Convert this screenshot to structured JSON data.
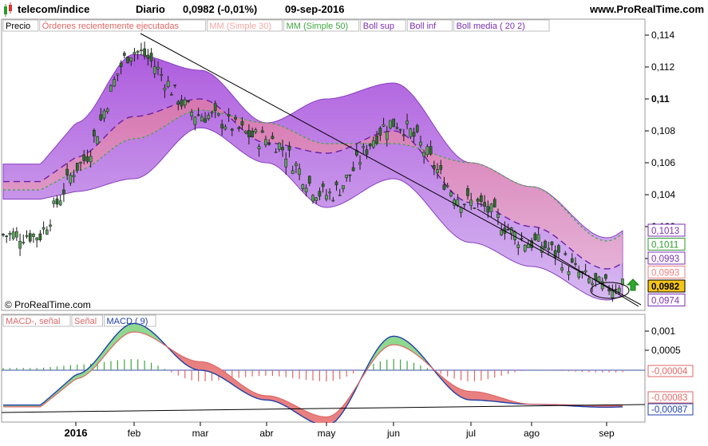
{
  "header": {
    "symbol": "telecom/indice",
    "period": "Diario",
    "last": "0,0982 (-0,01%)",
    "date": "09-sep-2016",
    "site": "www.ProRealTime.com",
    "logo_icon": "candlestick-icon"
  },
  "legend": {
    "items": [
      {
        "label": "Precio",
        "color": "#000000"
      },
      {
        "label": "Órdenes recientemente ejecutadas",
        "color": "#e06666"
      },
      {
        "label": "MM (Simple 30)",
        "color": "#f4a6a6"
      },
      {
        "label": "MM (Simple 50)",
        "color": "#3fa63f"
      },
      {
        "label": "Boll sup",
        "color": "#7b2fb5"
      },
      {
        "label": "Boll inf",
        "color": "#7b2fb5"
      },
      {
        "label": "Boll media ( 20 2)",
        "color": "#7b2fb5"
      }
    ]
  },
  "watermark": "© ProRealTime.com",
  "macd_legend": {
    "items": [
      {
        "label": "MACD-, señal",
        "color": "#e06666"
      },
      {
        "label": "Señal",
        "color": "#e06666"
      },
      {
        "label": "MACD ( 9)",
        "color": "#1f3fa8"
      }
    ]
  },
  "price_axis": {
    "ticks": [
      "0,114",
      "0,112",
      "0,11",
      "0,108",
      "0,106",
      "0,104",
      "0,102",
      "0,1"
    ],
    "badges": [
      {
        "label": "0,1013",
        "color": "#7b2fb5",
        "bg": "#ffffff",
        "value": 0.1013
      },
      {
        "label": "0,1011",
        "color": "#2e9b2e",
        "bg": "#ffffff",
        "value": 0.1011
      },
      {
        "label": "0,0993",
        "color": "#7b2fb5",
        "bg": "#ffffff",
        "value": 0.0993
      },
      {
        "label": "0,0993",
        "color": "#f08080",
        "bg": "#ffffff",
        "value": 0.0993
      },
      {
        "label": "0,0982",
        "color": "#000000",
        "bg": "#f5c518",
        "value": 0.0982
      },
      {
        "label": "0,0974",
        "color": "#7b2fb5",
        "bg": "#ffffff",
        "value": 0.0974
      }
    ]
  },
  "macd_axis": {
    "ticks": [
      "0,001",
      "0,0005"
    ],
    "badges": [
      {
        "label": "-0,00004",
        "color": "#e06666",
        "value": -4e-05
      },
      {
        "label": "-0,00083",
        "color": "#e06666",
        "value": -0.00083
      },
      {
        "label": "-0,00087",
        "color": "#1f3fa8",
        "value": -0.00087
      }
    ]
  },
  "time_axis": [
    "2016",
    "feb",
    "mar",
    "abr",
    "may",
    "jun",
    "jul",
    "ago",
    "sep"
  ],
  "chart_data": [
    {
      "type": "line",
      "title": "telecom/indice Diario",
      "x": [
        "2016-01",
        "2016-02",
        "2016-03",
        "2016-04",
        "2016-05",
        "2016-06",
        "2016-07",
        "2016-08",
        "2016-09"
      ],
      "ylim": [
        0.0968,
        0.1145
      ],
      "log_scale": false,
      "series": [
        {
          "name": "Precio",
          "values": [
            0.1058,
            0.113,
            0.109,
            0.1075,
            0.104,
            0.1085,
            0.1035,
            0.101,
            0.0982
          ]
        },
        {
          "name": "MM (Simple 50)",
          "values": [
            0.1055,
            0.1075,
            0.1093,
            0.1085,
            0.1072,
            0.1072,
            0.106,
            0.1045,
            0.1011
          ]
        },
        {
          "name": "Boll sup",
          "values": [
            0.1085,
            0.1128,
            0.1118,
            0.1085,
            0.11,
            0.111,
            0.106,
            0.1045,
            0.1013
          ]
        },
        {
          "name": "Boll inf",
          "values": [
            0.1042,
            0.105,
            0.1082,
            0.106,
            0.1032,
            0.105,
            0.101,
            0.0995,
            0.0974
          ]
        }
      ]
    },
    {
      "type": "line",
      "title": "MACD ( 9)",
      "x": [
        "2016-01",
        "2016-02",
        "2016-03",
        "2016-04",
        "2016-05",
        "2016-06",
        "2016-07",
        "2016-08",
        "2016-09"
      ],
      "ylim": [
        -0.0012,
        0.0012
      ],
      "series": [
        {
          "name": "MACD ( 9)",
          "values": [
            -0.0001,
            0.0011,
            0.0,
            -0.0007,
            -0.0013,
            0.0008,
            -0.0007,
            -0.0008,
            -0.00087
          ]
        },
        {
          "name": "Señal",
          "values": [
            -0.0002,
            0.0009,
            0.0002,
            -0.0006,
            -0.0011,
            0.0006,
            -0.0005,
            -0.0008,
            -0.00083
          ]
        },
        {
          "name": "MACD-, señal",
          "values": [
            0.0001,
            0.0003,
            -0.0002,
            -0.0001,
            -0.0002,
            0.0002,
            -0.0002,
            0.0,
            -4e-05
          ]
        }
      ]
    }
  ]
}
